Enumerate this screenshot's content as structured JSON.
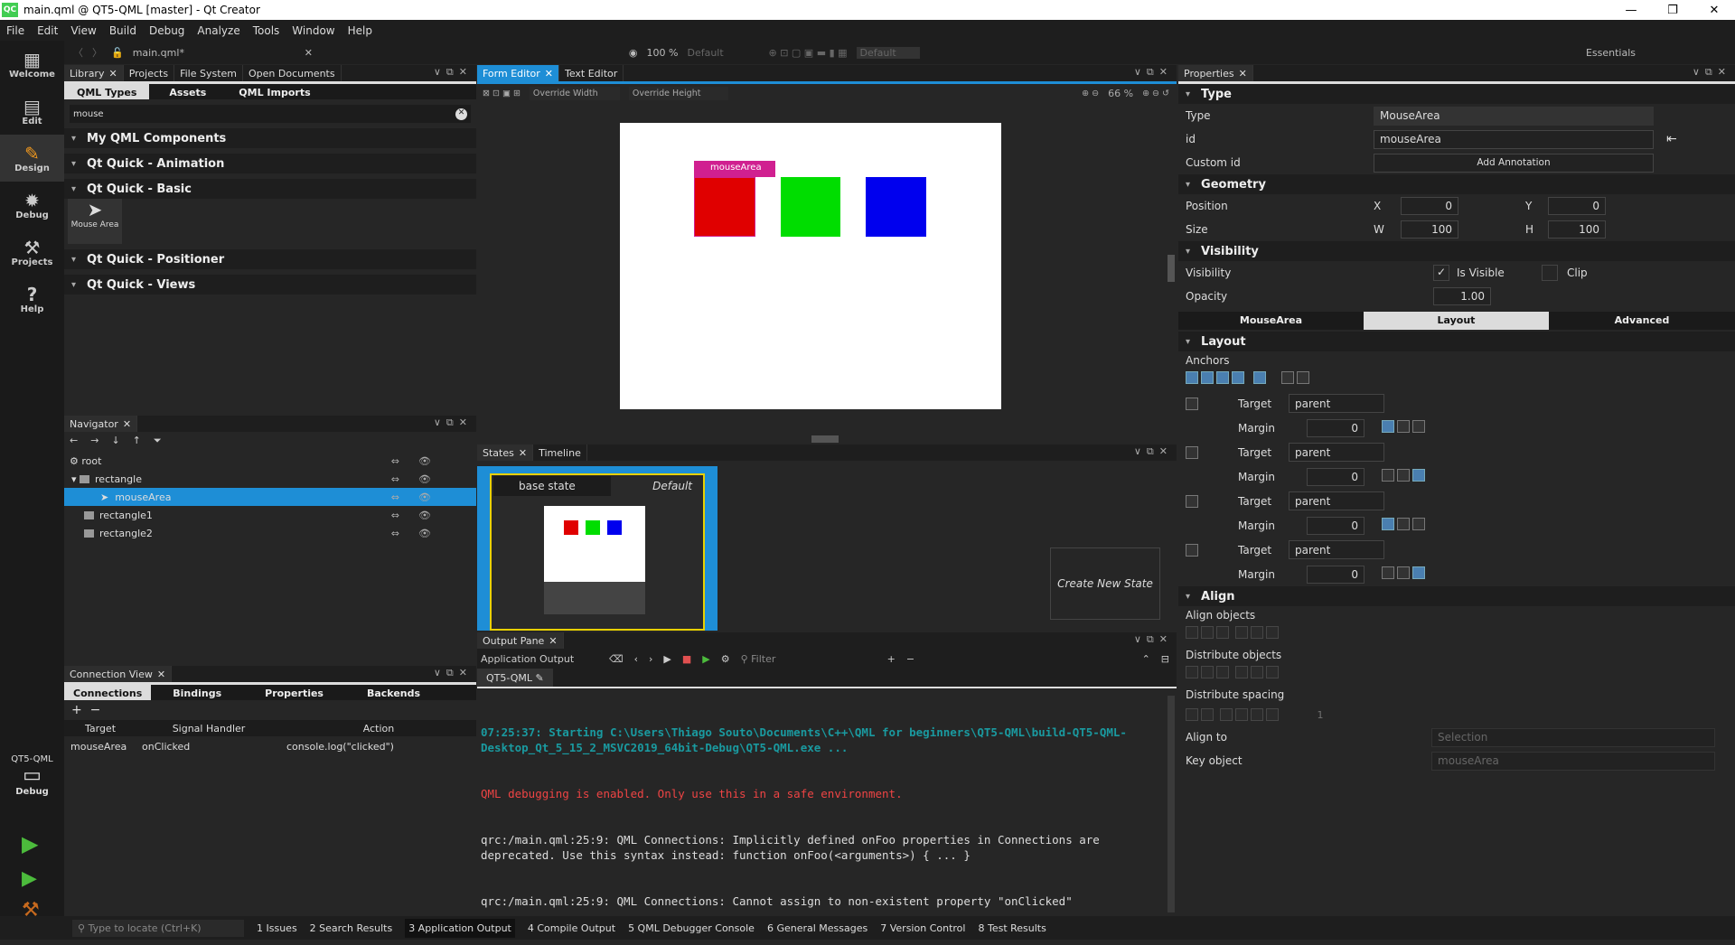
{
  "window": {
    "title": "main.qml @ QT5-QML [master] - Qt Creator",
    "logo": "QC",
    "controls": [
      "—",
      "❐",
      "✕"
    ]
  },
  "menu": [
    "File",
    "Edit",
    "View",
    "Build",
    "Debug",
    "Analyze",
    "Tools",
    "Window",
    "Help"
  ],
  "toolbar": {
    "file": "main.qml*",
    "zoom": "100 %",
    "style": "Default",
    "style2": "Default",
    "workspace": "Essentials"
  },
  "modes": [
    {
      "label": "Welcome",
      "icon": "grid-icon"
    },
    {
      "label": "Edit",
      "icon": "edit-icon"
    },
    {
      "label": "Design",
      "icon": "pencil-icon"
    },
    {
      "label": "Debug",
      "icon": "bug-icon"
    },
    {
      "label": "Projects",
      "icon": "wrench-icon"
    },
    {
      "label": "Help",
      "icon": "help-icon"
    }
  ],
  "kit": {
    "project": "QT5-QML",
    "mode": "Debug"
  },
  "library": {
    "tabs": [
      "Library",
      "Projects",
      "File System",
      "Open Documents"
    ],
    "subtabs": [
      "QML Types",
      "Assets",
      "QML Imports"
    ],
    "search": "mouse",
    "sections": [
      "My QML Components",
      "Qt Quick - Animation",
      "Qt Quick - Basic",
      "Qt Quick - Positioner",
      "Qt Quick - Views"
    ],
    "item": "Mouse Area"
  },
  "navigator": {
    "title": "Navigator",
    "items": [
      {
        "name": "root",
        "level": 0
      },
      {
        "name": "rectangle",
        "level": 1
      },
      {
        "name": "mouseArea",
        "level": 2,
        "selected": true
      },
      {
        "name": "rectangle1",
        "level": 1
      },
      {
        "name": "rectangle2",
        "level": 1
      }
    ]
  },
  "connections": {
    "title": "Connection View",
    "tabs": [
      "Connections",
      "Bindings",
      "Properties",
      "Backends"
    ],
    "headers": [
      "Target",
      "Signal Handler",
      "Action"
    ],
    "rows": [
      [
        "mouseArea",
        "onClicked",
        "console.log(\"clicked\")"
      ]
    ]
  },
  "editor": {
    "tabs": [
      "Form Editor",
      "Text Editor"
    ],
    "override_width": "Override Width",
    "override_height": "Override Height",
    "zoom": "66 %",
    "selection_label": "mouseArea",
    "rect_colors": [
      "#e00000",
      "#00dd00",
      "#0000ee"
    ],
    "selection_color": "#d02090"
  },
  "states": {
    "tabs": [
      "States",
      "Timeline"
    ],
    "base_state": "base state",
    "default": "Default",
    "create": "Create New State"
  },
  "output": {
    "title": "Output Pane",
    "subtitle": "Application Output",
    "filter_placeholder": "Filter",
    "run_tab": "QT5-QML",
    "lines": [
      {
        "text": "07:25:37: Starting C:\\Users\\Thiago Souto\\Documents\\C++\\QML for beginners\\QT5-QML\\build-QT5-QML-Desktop_Qt_5_15_2_MSVC2019_64bit-Debug\\QT5-QML.exe ...",
        "color": "#1a9aa0",
        "bold": true
      },
      {
        "text": "QML debugging is enabled. Only use this in a safe environment.",
        "color": "#ee4444"
      },
      {
        "text": "qrc:/main.qml:25:9: QML Connections: Implicitly defined onFoo properties in Connections are deprecated. Use this syntax instead: function onFoo(<arguments>) { ... }",
        "color": "#dddddd"
      },
      {
        "text": "qrc:/main.qml:25:9: QML Connections: Cannot assign to non-existent property \"onClicked\"",
        "color": "#dddddd"
      }
    ]
  },
  "properties": {
    "title": "Properties",
    "type_section": "Type",
    "type_label": "Type",
    "type_value": "MouseArea",
    "id_label": "id",
    "id_value": "mouseArea",
    "custom_id_label": "Custom id",
    "add_annotation": "Add Annotation",
    "geometry": "Geometry",
    "position": "Position",
    "size": "Size",
    "x_label": "X",
    "y_label": "Y",
    "w_label": "W",
    "h_label": "H",
    "x": "0",
    "y": "0",
    "w": "100",
    "h": "100",
    "visibility_section": "Visibility",
    "visibility_label": "Visibility",
    "is_visible": "Is Visible",
    "is_visible_checked": true,
    "clip": "Clip",
    "clip_checked": false,
    "opacity_label": "Opacity",
    "opacity": "1.00",
    "tabs": [
      "MouseArea",
      "Layout",
      "Advanced"
    ],
    "active_tab": "Layout",
    "layout": "Layout",
    "anchors": "Anchors",
    "target_label": "Target",
    "target": "parent",
    "margin_label": "Margin",
    "margin": "0",
    "align": "Align",
    "align_objects": "Align objects",
    "distribute_objects": "Distribute objects",
    "distribute_spacing": "Distribute spacing",
    "spacing_value": "1",
    "align_to": "Align to",
    "align_to_value": "Selection",
    "key_object": "Key object",
    "key_object_value": "mouseArea"
  },
  "statusbar": {
    "locate_placeholder": "Type to locate (Ctrl+K)",
    "items": [
      "1  Issues",
      "2  Search Results",
      "3  Application Output",
      "4  Compile Output",
      "5  QML Debugger Console",
      "6  General Messages",
      "7  Version Control",
      "8  Test Results"
    ]
  }
}
